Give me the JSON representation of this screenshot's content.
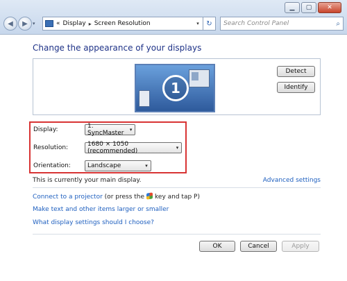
{
  "window": {
    "caption_buttons": {
      "minimize": "▁",
      "maximize": "▢",
      "close": "✕"
    }
  },
  "nav": {
    "back_icon": "◀",
    "forward_icon": "▶",
    "history_icon": "▾",
    "breadcrumb_prefix": "«",
    "breadcrumb": [
      "Display",
      "Screen Resolution"
    ],
    "crumb_sep": "▸",
    "address_drop": "▾",
    "refresh_icon": "↻",
    "search_placeholder": "Search Control Panel",
    "search_icon": "⌕"
  },
  "page": {
    "title": "Change the appearance of your displays",
    "monitor_number": "1",
    "detect_label": "Detect",
    "identify_label": "Identify"
  },
  "settings": {
    "display_label": "Display:",
    "display_value": "1. SyncMaster",
    "resolution_label": "Resolution:",
    "resolution_value": "1680 × 1050 (recommended)",
    "orientation_label": "Orientation:",
    "orientation_value": "Landscape",
    "dropdown_icon": "▾"
  },
  "info": {
    "main_display_note": "This is currently your main display.",
    "advanced_settings": "Advanced settings"
  },
  "links": {
    "projector_link": "Connect to a projector",
    "projector_text_before": "(or press the",
    "projector_text_after": "key and tap P)",
    "text_size_link": "Make text and other items larger or smaller",
    "help_link": "What display settings should I choose?"
  },
  "buttons": {
    "ok": "OK",
    "cancel": "Cancel",
    "apply": "Apply"
  },
  "colors": {
    "link": "#1e5fbf",
    "title": "#1e3287",
    "highlight_border": "#d83333"
  }
}
